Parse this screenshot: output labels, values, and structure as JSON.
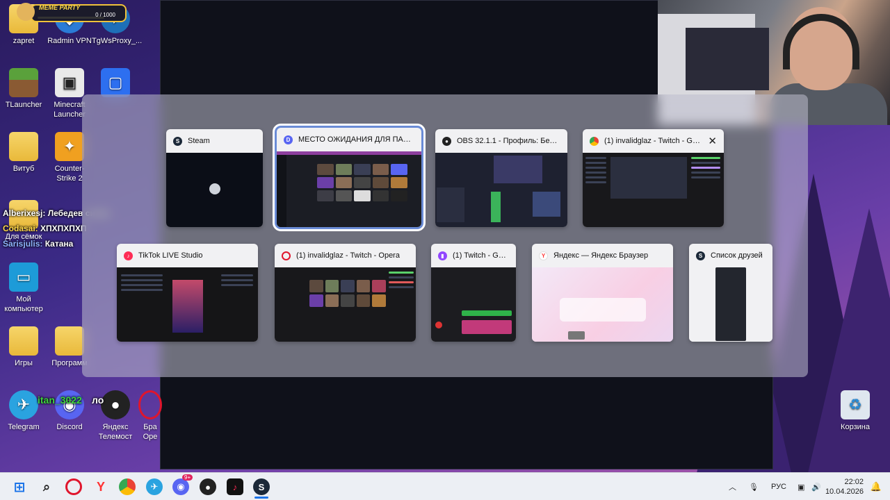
{
  "desktop": {
    "icons": [
      {
        "label": "zapret"
      },
      {
        "label": "Radmin VPN"
      },
      {
        "label": "TgWsProxy_..."
      },
      {
        "label": "TLauncher"
      },
      {
        "label": "Minecraft Launcher"
      },
      {
        "label": "Витуб"
      },
      {
        "label": "Counter-Strike 2"
      },
      {
        "label": "Для сёмок"
      },
      {
        "label": "Мой компьютер"
      },
      {
        "label": "Игры"
      },
      {
        "label": "Программ"
      },
      {
        "label": "Telegram"
      },
      {
        "label": "Discord"
      },
      {
        "label": "Яндекс Телемост"
      },
      {
        "label": "Бра Оре"
      },
      {
        "label": "Корзина"
      }
    ],
    "chat_overlay": [
      {
        "user": "Alberixesj:",
        "msg": "Лебедев сигма",
        "color": "#ffffff"
      },
      {
        "user": "Codasai:",
        "msg": "ХПХПХПХП",
        "color": "#ffd84a"
      },
      {
        "user": "Sarisjulis:",
        "msg": "Катана",
        "color": "#8fb4ff"
      }
    ],
    "overlay_green": "itan_3022",
    "overlay_white": "ло"
  },
  "meme_widget": {
    "title": "MEME PARTY",
    "counter": "0 / 1000",
    "progress": 0
  },
  "switcher": {
    "windows": [
      {
        "title": "Steam",
        "icon": "steam-icon"
      },
      {
        "title": "МЕСТО ОЖИДАНИЯ ДЛЯ ПАРН...",
        "icon": "discord-icon"
      },
      {
        "title": "OBS 32.1.1 - Профиль: Безым...",
        "icon": "obs-icon"
      },
      {
        "title": "(1) invalidglaz - Twitch - Go...",
        "icon": "chrome-icon"
      },
      {
        "title": "TikTok LIVE Studio",
        "icon": "tiktok-icon"
      },
      {
        "title": "(1) invalidglaz - Twitch - Opera",
        "icon": "opera-icon"
      },
      {
        "title": "(1) Twitch - Goo...",
        "icon": "twitch-icon"
      },
      {
        "title": "Яндекс — Яндекс Браузер",
        "icon": "yandex-icon"
      },
      {
        "title": "Список друзей",
        "icon": "steam-icon"
      }
    ],
    "close_glyph": "✕"
  },
  "taskbar": {
    "language": "РУС",
    "time": "22:02",
    "date": "10.04.2026",
    "discord_badge": "9+"
  },
  "colors": {
    "accent": "#6a8bd6",
    "steam": "#1b2838",
    "discord": "#5865f2",
    "twitch": "#9146ff",
    "tiktok": "#fe2c55",
    "opera": "#e0152c",
    "yandex": "#ff3333"
  }
}
